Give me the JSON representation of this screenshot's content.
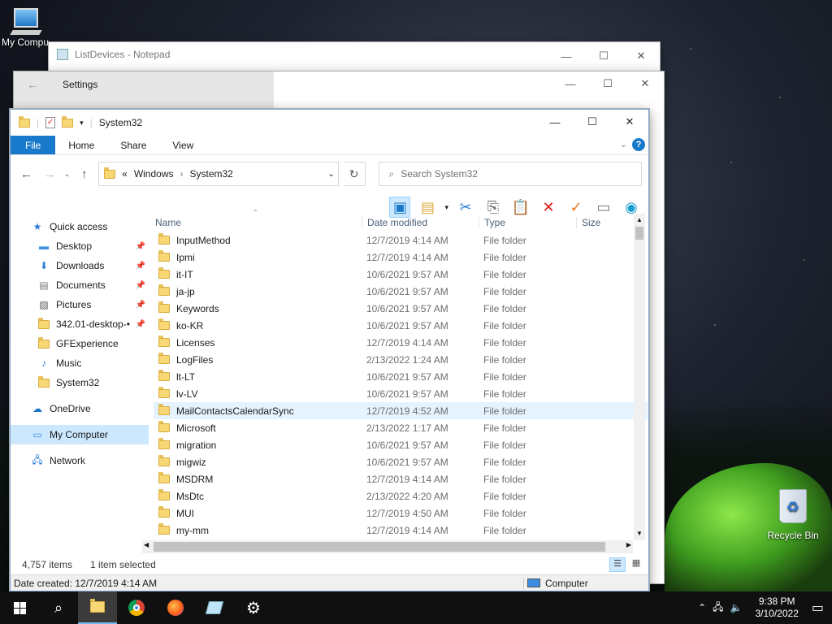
{
  "desktop": {
    "my_computer_label": "My Compu",
    "recycle_bin_label": "Recycle Bin"
  },
  "notepad": {
    "title": "ListDevices - Notepad"
  },
  "settings": {
    "title": "Settings"
  },
  "explorer": {
    "title": "System32",
    "ribbon_tabs": [
      "File",
      "Home",
      "Share",
      "View"
    ],
    "address": {
      "parts": [
        "Windows",
        "System32"
      ]
    },
    "search": {
      "placeholder": "Search System32"
    },
    "nav": [
      {
        "label": "Quick access",
        "icon": "star-icon",
        "level": "top"
      },
      {
        "label": "Desktop",
        "icon": "desktop-icon",
        "level": "sub",
        "pinned": true
      },
      {
        "label": "Downloads",
        "icon": "download-arrow-icon",
        "level": "sub",
        "pinned": true
      },
      {
        "label": "Documents",
        "icon": "documents-icon",
        "level": "sub",
        "pinned": true
      },
      {
        "label": "Pictures",
        "icon": "pictures-icon",
        "level": "sub",
        "pinned": true
      },
      {
        "label": "342.01-desktop-•",
        "icon": "folder-icon",
        "level": "sub",
        "pinned": true
      },
      {
        "label": "GFExperience",
        "icon": "folder-icon",
        "level": "sub"
      },
      {
        "label": "Music",
        "icon": "music-icon",
        "level": "sub"
      },
      {
        "label": "System32",
        "icon": "folder-icon",
        "level": "sub"
      },
      {
        "label": "OneDrive",
        "icon": "cloud-icon",
        "level": "top"
      },
      {
        "label": "My Computer",
        "icon": "computer-icon",
        "level": "top",
        "selected": true
      },
      {
        "label": "Network",
        "icon": "network-icon",
        "level": "top"
      }
    ],
    "columns": [
      "Name",
      "Date modified",
      "Type",
      "Size"
    ],
    "rows": [
      {
        "name": "InputMethod",
        "date": "12/7/2019 4:14 AM",
        "type": "File folder"
      },
      {
        "name": "Ipmi",
        "date": "12/7/2019 4:14 AM",
        "type": "File folder"
      },
      {
        "name": "it-IT",
        "date": "10/6/2021 9:57 AM",
        "type": "File folder"
      },
      {
        "name": "ja-jp",
        "date": "10/6/2021 9:57 AM",
        "type": "File folder"
      },
      {
        "name": "Keywords",
        "date": "10/6/2021 9:57 AM",
        "type": "File folder"
      },
      {
        "name": "ko-KR",
        "date": "10/6/2021 9:57 AM",
        "type": "File folder"
      },
      {
        "name": "Licenses",
        "date": "12/7/2019 4:14 AM",
        "type": "File folder"
      },
      {
        "name": "LogFiles",
        "date": "2/13/2022 1:24 AM",
        "type": "File folder"
      },
      {
        "name": "lt-LT",
        "date": "10/6/2021 9:57 AM",
        "type": "File folder"
      },
      {
        "name": "lv-LV",
        "date": "10/6/2021 9:57 AM",
        "type": "File folder"
      },
      {
        "name": "MailContactsCalendarSync",
        "date": "12/7/2019 4:52 AM",
        "type": "File folder",
        "hover": true
      },
      {
        "name": "Microsoft",
        "date": "2/13/2022 1:17 AM",
        "type": "File folder"
      },
      {
        "name": "migration",
        "date": "10/6/2021 9:57 AM",
        "type": "File folder"
      },
      {
        "name": "migwiz",
        "date": "10/6/2021 9:57 AM",
        "type": "File folder"
      },
      {
        "name": "MSDRM",
        "date": "12/7/2019 4:14 AM",
        "type": "File folder"
      },
      {
        "name": "MsDtc",
        "date": "2/13/2022 4:20 AM",
        "type": "File folder"
      },
      {
        "name": "MUI",
        "date": "12/7/2019 4:50 AM",
        "type": "File folder"
      },
      {
        "name": "my-mm",
        "date": "12/7/2019 4:14 AM",
        "type": "File folder"
      }
    ],
    "status": {
      "count": "4,757 items",
      "selected": "1 item selected"
    },
    "details": {
      "date_created": "Date created: 12/7/2019 4:14 AM",
      "location": "Computer"
    }
  },
  "taskbar": {
    "time": "9:38 PM",
    "date": "3/10/2022"
  }
}
